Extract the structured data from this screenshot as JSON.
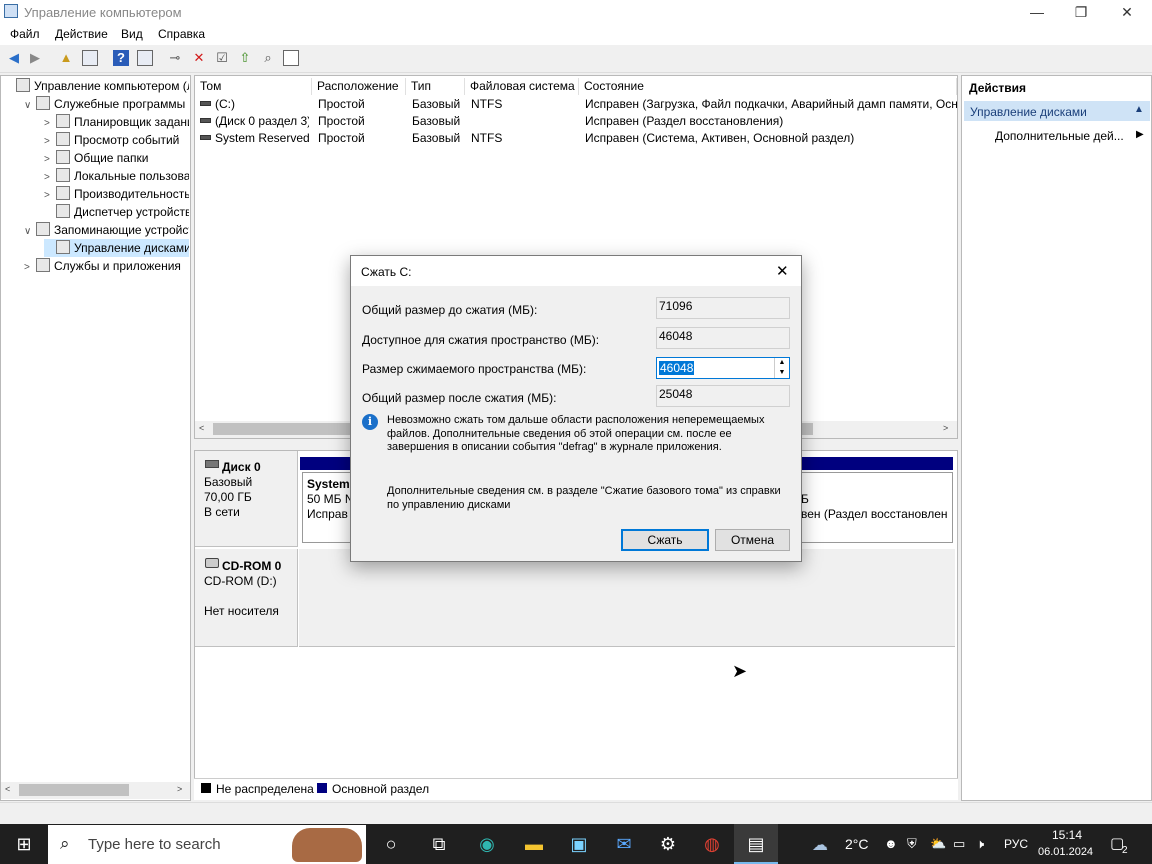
{
  "window": {
    "title": "Управление компьютером",
    "minimize": "—",
    "maximize": "❐",
    "close": "✕"
  },
  "menu": [
    "Файл",
    "Действие",
    "Вид",
    "Справка"
  ],
  "toolbar_icons": [
    "back-arrow-icon",
    "forward-arrow-icon",
    "folder-up-icon",
    "show-hide-tree-icon",
    "help-icon",
    "properties-icon",
    "connect-icon",
    "delete-icon",
    "checklist-icon",
    "import-icon",
    "search-icon",
    "details-icon"
  ],
  "tree": [
    {
      "label": "Управление компьютером (л",
      "level": 0,
      "arrow": ""
    },
    {
      "label": "Служебные программы",
      "level": 1,
      "arrow": "∨"
    },
    {
      "label": "Планировщик заданий",
      "level": 2,
      "arrow": ">"
    },
    {
      "label": "Просмотр событий",
      "level": 2,
      "arrow": ">"
    },
    {
      "label": "Общие папки",
      "level": 2,
      "arrow": ">"
    },
    {
      "label": "Локальные пользовате",
      "level": 2,
      "arrow": ">"
    },
    {
      "label": "Производительность",
      "level": 2,
      "arrow": ">"
    },
    {
      "label": "Диспетчер устройств",
      "level": 2,
      "arrow": ""
    },
    {
      "label": "Запоминающие устройст",
      "level": 1,
      "arrow": "∨"
    },
    {
      "label": "Управление дисками",
      "level": 2,
      "arrow": "",
      "selected": true
    },
    {
      "label": "Службы и приложения",
      "level": 1,
      "arrow": ">"
    }
  ],
  "volumes": {
    "headers": [
      "Том",
      "Расположение",
      "Тип",
      "Файловая система",
      "Состояние"
    ],
    "rows": [
      [
        "(C:)",
        "Простой",
        "Базовый",
        "NTFS",
        "Исправен (Загрузка, Файл подкачки, Аварийный дамп памяти, Осн"
      ],
      [
        "(Диск 0 раздел 3)",
        "Простой",
        "Базовый",
        "",
        "Исправен (Раздел восстановления)"
      ],
      [
        "System Reserved",
        "Простой",
        "Базовый",
        "NTFS",
        "Исправен (Система, Активен, Основной раздел)"
      ]
    ]
  },
  "disks": {
    "disk0": {
      "name": "Диск 0",
      "type": "Базовый",
      "size": "70,00 ГБ",
      "status": "В сети",
      "part1": {
        "name": "System",
        "size": "50 МБ N",
        "status": "Исправ"
      },
      "part3": {
        "size": "Б",
        "status": "вен (Раздел восстановлен"
      }
    },
    "cdrom": {
      "name": "CD-ROM 0",
      "drive": "CD-ROM (D:)",
      "status": "Нет носителя"
    }
  },
  "legend": [
    "Не распределена",
    "Основной раздел"
  ],
  "legend_colors": [
    "#000000",
    "#000080"
  ],
  "actions": {
    "title": "Действия",
    "section": "Управление дисками",
    "more": "Дополнительные дей..."
  },
  "dialog": {
    "title": "Сжать C:",
    "total_before_label": "Общий размер до сжатия (МБ):",
    "total_before": "71096",
    "available_label": "Доступное для сжатия пространство (МБ):",
    "available": "46048",
    "shrink_label": "Размер сжимаемого пространства (МБ):",
    "shrink": "46048",
    "total_after_label": "Общий размер после сжатия (МБ):",
    "total_after": "25048",
    "info": "Невозможно сжать том дальше области расположения неперемещаемых файлов. Дополнительные сведения об этой операции см. после ее завершения в описании события \"defrag\" в журнале приложения.",
    "help": "Дополнительные сведения см. в разделе \"Сжатие базового тома\" из справки по управлению дисками",
    "ok": "Сжать",
    "cancel": "Отмена"
  },
  "taskbar": {
    "search_placeholder": "Type here to search",
    "temp": "2°C",
    "lang": "РУС",
    "time": "15:14",
    "date": "06.01.2024",
    "notif": "2"
  }
}
